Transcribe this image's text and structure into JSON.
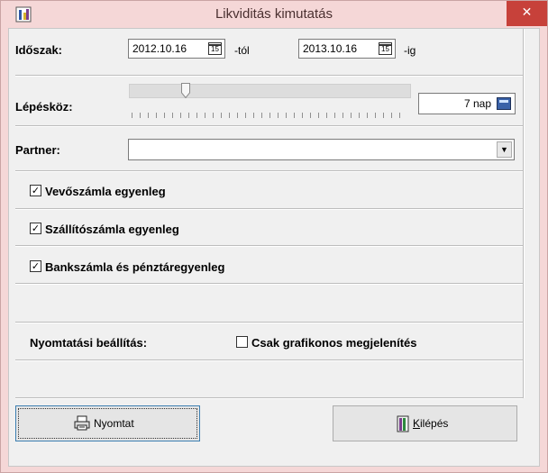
{
  "window": {
    "title": "Likviditás kimutatás",
    "close_glyph": "✕",
    "icon": "app-icon"
  },
  "period": {
    "label": "Időszak:",
    "from_date": "2012.10.16",
    "from_suffix": "-tól",
    "to_date": "2013.10.16",
    "to_suffix": "-ig",
    "calendar_glyph": "15"
  },
  "step": {
    "label": "Lépésköz:",
    "value": "7 nap",
    "slider_level_fraction": 0.2
  },
  "partner": {
    "label": "Partner:",
    "value": "",
    "arrow_glyph": "▼"
  },
  "options": {
    "vevo": {
      "label": "Vevőszámla egyenleg",
      "checked": true
    },
    "szallito": {
      "label": "Szállítószámla egyenleg",
      "checked": true
    },
    "bank": {
      "label": "Bankszámla és pénztáregyenleg",
      "checked": true
    },
    "check_glyph": "✓"
  },
  "print_settings": {
    "label": "Nyomtatási beállítás:",
    "graph_only_label": "Csak grafikonos megjelenítés",
    "graph_only_checked": false
  },
  "buttons": {
    "print": "Nyomtat",
    "exit_prefix": "K",
    "exit_rest": "ilépés"
  },
  "colors": {
    "titlebar": "#f5d7d7",
    "close": "#c7413a",
    "client": "#f0f0f0"
  }
}
